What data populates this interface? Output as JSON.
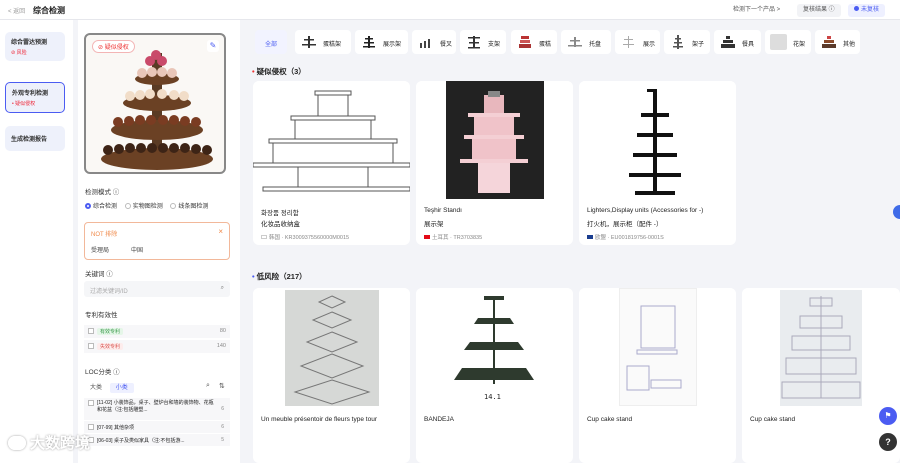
{
  "header": {
    "back": "< 返回",
    "title": "综合检测",
    "next_product": "检测下一个产品 >",
    "check_result": "复核结果 ⓘ",
    "review_status": "未复核"
  },
  "nav": [
    {
      "label": "综合雷达预测",
      "sub": "风险"
    },
    {
      "label": "外观专利检测",
      "sub": "• 疑似侵权"
    },
    {
      "label": "生成检测报告",
      "sub": ""
    }
  ],
  "query": {
    "tag": "疑似侵权",
    "mode_label": "检测模式 ⓘ",
    "modes": [
      "综合检测",
      "实物图检测",
      "线条图检测"
    ],
    "not_label": "NOT 排除",
    "not_values": [
      "受理局",
      "中国"
    ],
    "not_close": "×",
    "keyword_label": "关键词 ⓘ",
    "keyword_placeholder": "过滤关键词/ID",
    "validity_label": "专利有效性",
    "validity": [
      {
        "name": "有效专利",
        "count": "80"
      },
      {
        "name": "失效专利",
        "count": "140"
      }
    ],
    "loc_label": "LOC分类 ⓘ",
    "loc_tabs": [
      "大类",
      "小类"
    ],
    "loc_items": [
      {
        "text": "[11-02] 小装饰品，桌子、壁炉台和墙的装饰物、花瓶和花盆（注:包括雕塑...",
        "count": "6"
      },
      {
        "text": "[07-99] 其他杂项",
        "count": "6"
      },
      {
        "text": "[06-03] 桌子及类似家具（注:不包括游...",
        "count": "5"
      }
    ]
  },
  "categories": [
    "全部",
    "蛋糕架",
    "展示架",
    "餐叉",
    "支架",
    "蛋糕",
    "托盘",
    "展示",
    "架子",
    "餐具",
    "花架",
    "其他"
  ],
  "sections": [
    {
      "title": "疑似侵权（3）"
    },
    {
      "title": "低风险（217）"
    }
  ],
  "cards_top": [
    {
      "t1": "화장품 정리함",
      "t2": "化妆品收纳盒",
      "t3": "韩国 · KR3009375560000M0015"
    },
    {
      "t1": "Teşhir Standı",
      "t2": "展示架",
      "t3": "土耳其 · TR3703835"
    },
    {
      "t1": "Lighters,Display units (Accessories for -)",
      "t2": "打火机，展示柜（配件 -）",
      "t3": "欧盟 · EU001819756-0001S"
    }
  ],
  "cards_bottom": [
    {
      "t1": "Un meuble présentoir de fleurs type tour"
    },
    {
      "t1": "BANDEJA",
      "code": "14.1"
    },
    {
      "t1": "Cup cake stand"
    },
    {
      "t1": "Cup cake stand"
    }
  ],
  "watermark": "大数跨境",
  "colors": {
    "accent": "#4b5cf2",
    "danger": "#e23333"
  }
}
